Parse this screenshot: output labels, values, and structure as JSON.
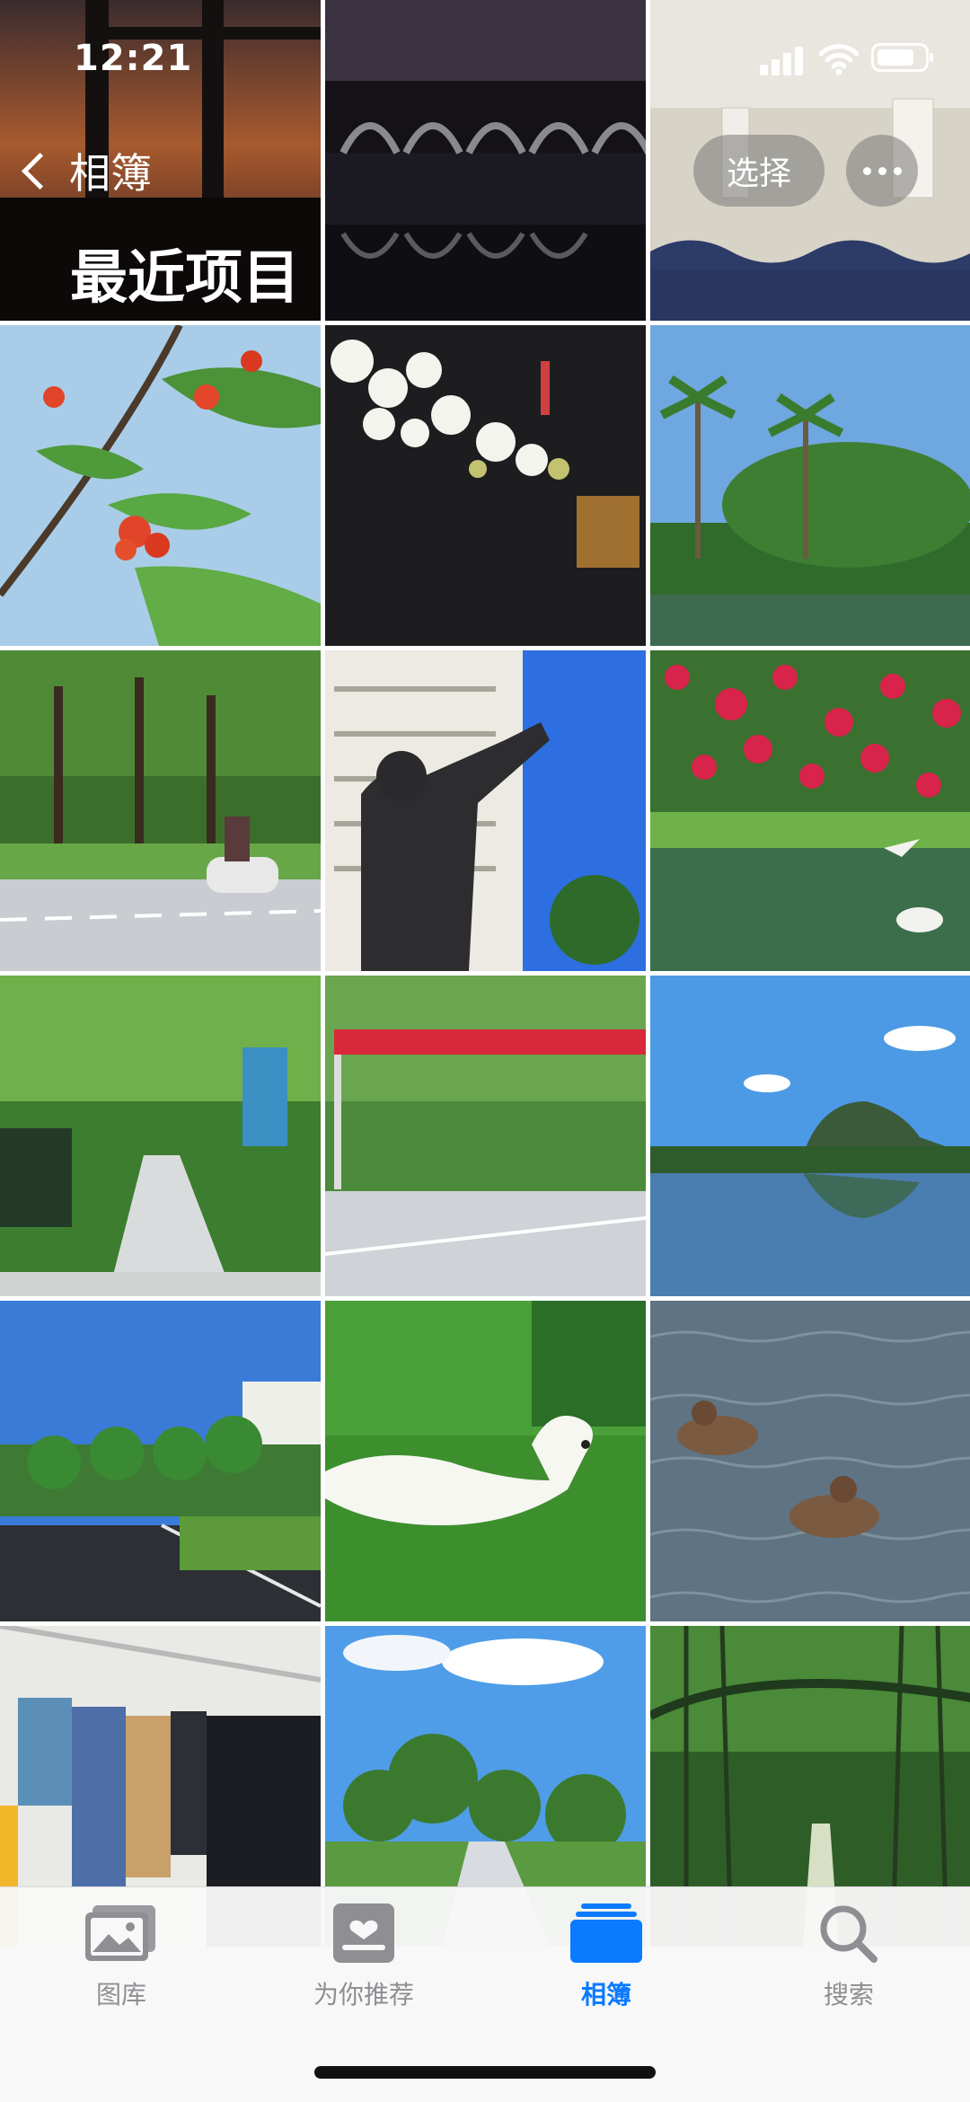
{
  "status_bar": {
    "time": "12:21"
  },
  "nav": {
    "back_label": "相簿",
    "title": "最近项目",
    "select_label": "选择"
  },
  "photos": [
    {
      "label": "dusk-silhouette"
    },
    {
      "label": "bridge-reflection-night"
    },
    {
      "label": "wall-corridor"
    },
    {
      "label": "red-flowers-sky"
    },
    {
      "label": "white-blossoms-night"
    },
    {
      "label": "palm-trees-pond"
    },
    {
      "label": "campus-road-scooter"
    },
    {
      "label": "statue-building"
    },
    {
      "label": "red-flowers-lake-birds"
    },
    {
      "label": "tree-lined-walkway"
    },
    {
      "label": "road-red-banner"
    },
    {
      "label": "lake-mountain"
    },
    {
      "label": "road-blue-sky-building"
    },
    {
      "label": "white-peacock-grass"
    },
    {
      "label": "ducks-water"
    },
    {
      "label": "laundry-window"
    },
    {
      "label": "path-trees-clouds"
    },
    {
      "label": "banyan-trees"
    }
  ],
  "tabbar": {
    "items": [
      {
        "label": "图库",
        "icon": "photo-library-icon"
      },
      {
        "label": "为你推荐",
        "icon": "for-you-icon"
      },
      {
        "label": "相簿",
        "icon": "albums-icon",
        "active": true
      },
      {
        "label": "搜索",
        "icon": "search-icon"
      }
    ]
  },
  "colors": {
    "accent": "#0a7aff",
    "inactive": "#8e8e93"
  }
}
